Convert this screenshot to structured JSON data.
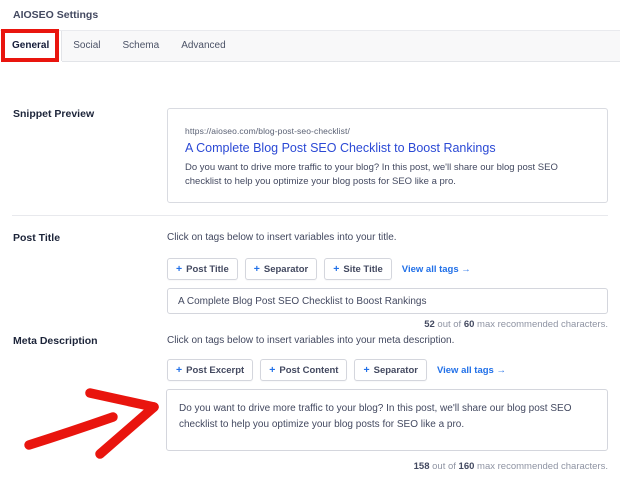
{
  "panel": {
    "title": "AIOSEO Settings"
  },
  "tabs": [
    {
      "label": "General",
      "active": true
    },
    {
      "label": "Social",
      "active": false
    },
    {
      "label": "Schema",
      "active": false
    },
    {
      "label": "Advanced",
      "active": false
    }
  ],
  "icons": {
    "plus": "+"
  },
  "snippet_preview": {
    "label": "Snippet Preview",
    "url": "https://aioseo.com/blog-post-seo-checklist/",
    "title": "A Complete Blog Post SEO Checklist to Boost Rankings",
    "description": "Do you want to drive more traffic to your blog? In this post, we'll share our blog post SEO checklist to help you optimize your blog posts for SEO like a pro."
  },
  "post_title": {
    "label": "Post Title",
    "helper": "Click on tags below to insert variables into your title.",
    "tag_buttons": [
      "Post Title",
      "Separator",
      "Site Title"
    ],
    "view_all_tags": "View all tags →",
    "value": "A Complete Blog Post SEO Checklist to Boost Rankings",
    "char_count": {
      "current": "52",
      "separator": " out of ",
      "max": "60",
      "suffix": " max recommended characters."
    }
  },
  "meta_description": {
    "label": "Meta Description",
    "helper": "Click on tags below to insert variables into your meta description.",
    "tag_buttons": [
      "Post Excerpt",
      "Post Content",
      "Separator"
    ],
    "view_all_tags": "View all tags →",
    "value": "Do you want to drive more traffic to your blog? In this post, we'll share our blog post SEO checklist to help you optimize your blog posts for SEO like a pro.",
    "char_count": {
      "current": "158",
      "separator": " out of ",
      "max": "160",
      "suffix": " max recommended characters."
    }
  },
  "colors": {
    "accent_blue": "#2170e8",
    "snippet_title_blue": "#2b49d5",
    "annotation_red": "#e9150e"
  }
}
